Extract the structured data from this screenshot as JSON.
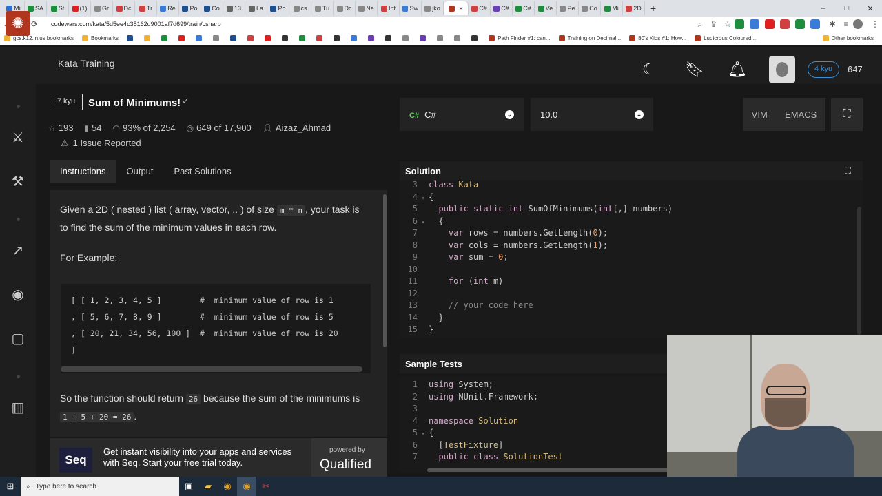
{
  "browser": {
    "tabs": [
      {
        "label": "Mi",
        "color": "#2a6fd6"
      },
      {
        "label": "SA",
        "color": "#1e8e3e"
      },
      {
        "label": "St",
        "color": "#1e8e3e"
      },
      {
        "label": "(1)",
        "color": "#e02020"
      },
      {
        "label": "Gr",
        "color": "#888888"
      },
      {
        "label": "Dc",
        "color": "#d04040"
      },
      {
        "label": "Tr",
        "color": "#d04040"
      },
      {
        "label": "Re",
        "color": "#3a7bd5"
      },
      {
        "label": "Po",
        "color": "#1f4f8f"
      },
      {
        "label": "Co",
        "color": "#1f4f8f"
      },
      {
        "label": "13",
        "color": "#666666"
      },
      {
        "label": "La",
        "color": "#666666"
      },
      {
        "label": "Po",
        "color": "#1f4f8f"
      },
      {
        "label": "cs",
        "color": "#888888"
      },
      {
        "label": "Tu",
        "color": "#888888"
      },
      {
        "label": "Dc",
        "color": "#888888"
      },
      {
        "label": "Ne",
        "color": "#888888"
      },
      {
        "label": "Int",
        "color": "#d04040"
      },
      {
        "label": "Sw",
        "color": "#3a7bd5"
      },
      {
        "label": "jko",
        "color": "#888888"
      },
      {
        "label": "",
        "color": "#b1361e",
        "active": true
      },
      {
        "label": "C#",
        "color": "#d04040"
      },
      {
        "label": "C#",
        "color": "#6a3fb5"
      },
      {
        "label": "C#",
        "color": "#1e8e3e"
      },
      {
        "label": "Ve",
        "color": "#1e8e3e"
      },
      {
        "label": "Pe",
        "color": "#888888"
      },
      {
        "label": "Co",
        "color": "#888888"
      },
      {
        "label": "Mi",
        "color": "#1e8e3e"
      },
      {
        "label": "2D",
        "color": "#d04040"
      }
    ],
    "new_tab_label": "+",
    "window_controls": [
      "–",
      "□",
      "✕"
    ],
    "url": "codewars.com/kata/5d5ee4c35162d9001af7d699/train/csharp",
    "bookmarks": [
      {
        "label": "gcs.k12.in.us bookmarks",
        "color": "#f2b233"
      },
      {
        "label": "Bookmarks",
        "color": "#f2b233"
      },
      {
        "label": "",
        "color": "#1f4f8f"
      },
      {
        "label": "",
        "color": "#f2b233"
      },
      {
        "label": "",
        "color": "#1e8e3e"
      },
      {
        "label": "",
        "color": "#e02020"
      },
      {
        "label": "",
        "color": "#3a7bd5"
      },
      {
        "label": "",
        "color": "#888888"
      },
      {
        "label": "",
        "color": "#1f4f8f"
      },
      {
        "label": "",
        "color": "#d04040"
      },
      {
        "label": "",
        "color": "#e02020"
      },
      {
        "label": "",
        "color": "#333333"
      },
      {
        "label": "",
        "color": "#1e8e3e"
      },
      {
        "label": "",
        "color": "#d04040"
      },
      {
        "label": "",
        "color": "#333333"
      },
      {
        "label": "",
        "color": "#3a7bd5"
      },
      {
        "label": "",
        "color": "#6a3fb5"
      },
      {
        "label": "",
        "color": "#333333"
      },
      {
        "label": "",
        "color": "#888888"
      },
      {
        "label": "",
        "color": "#6a3fb5"
      },
      {
        "label": "",
        "color": "#888888"
      },
      {
        "label": "",
        "color": "#888888"
      },
      {
        "label": "",
        "color": "#333333"
      },
      {
        "label": "Path Finder #1: can...",
        "color": "#b1361e"
      },
      {
        "label": "Training on Decimal...",
        "color": "#b1361e"
      },
      {
        "label": "80's Kids #1: How...",
        "color": "#b1361e"
      },
      {
        "label": "Ludicrous Coloured...",
        "color": "#b1361e"
      },
      {
        "label": "Other bookmarks",
        "color": "#f2b233"
      }
    ]
  },
  "topbar": {
    "section_title": "Kata Training",
    "rank": "4 kyu",
    "honor": "647"
  },
  "kata": {
    "kyu": "7 kyu",
    "title": "Sum of Minimums!",
    "check_icon": "✓",
    "stats": {
      "stars": "193",
      "bookmarks": "54",
      "satisfaction": "93% of 2,254",
      "completed": "649 of 17,900",
      "author": "Aizaz_Ahmad"
    },
    "issues": "1 Issue Reported"
  },
  "tabs": [
    "Instructions",
    "Output",
    "Past Solutions"
  ],
  "instructions": {
    "p1_a": "Given a 2D ( nested ) list ( array, vector, .. ) of size",
    "p1_code": "m * n",
    "p1_b": ", your task is to find the sum of the minimum values in each row.",
    "p2": "For Example:",
    "example_lines": [
      "[ [ 1, 2, 3, 4, 5 ]        #  minimum value of row is 1",
      ", [ 5, 6, 7, 8, 9 ]        #  minimum value of row is 5",
      ", [ 20, 21, 34, 56, 100 ]  #  minimum value of row is 20",
      "]"
    ],
    "p3_a": "So the function should return",
    "p3_code1": "26",
    "p3_b": "because the sum of the minimums is",
    "p3_code2": "1 + 5 + 20 = 26",
    "p3_c": "."
  },
  "ad": {
    "logo": "Seq",
    "text": "Get instant visibility into your apps and services with Seq. Start your free trial today.",
    "powered_by": "powered by",
    "brand": "Qualified"
  },
  "controls": {
    "language": "C#",
    "version": "10.0",
    "keymaps": [
      "VIM",
      "EMACS"
    ]
  },
  "solution": {
    "title": "Solution",
    "lines": [
      {
        "n": "3",
        "fold": "",
        "html": "<span class='kw'>class</span> <span class='ty'>Kata</span>"
      },
      {
        "n": "4",
        "fold": "▾",
        "html": "{"
      },
      {
        "n": "5",
        "fold": "",
        "html": "  <span class='kw'>public static int</span> SumOfMinimums(<span class='kw'>int</span>[,] numbers)"
      },
      {
        "n": "6",
        "fold": "▾",
        "html": "  {"
      },
      {
        "n": "7",
        "fold": "",
        "html": "    <span class='kw'>var</span> rows = numbers.GetLength(<span class='num'>0</span>);"
      },
      {
        "n": "8",
        "fold": "",
        "html": "    <span class='kw'>var</span> cols = numbers.GetLength(<span class='num'>1</span>);"
      },
      {
        "n": "9",
        "fold": "",
        "html": "    <span class='kw'>var</span> sum = <span class='num'>0</span>;"
      },
      {
        "n": "10",
        "fold": "",
        "html": ""
      },
      {
        "n": "11",
        "fold": "",
        "html": "    <span class='kw'>for</span> (<span class='kw'>int</span> m)"
      },
      {
        "n": "12",
        "fold": "",
        "html": ""
      },
      {
        "n": "13",
        "fold": "",
        "html": "    <span class='cm'>// your code here</span>"
      },
      {
        "n": "14",
        "fold": "",
        "html": "  }"
      },
      {
        "n": "15",
        "fold": "",
        "html": "}"
      }
    ]
  },
  "tests": {
    "title": "Sample Tests",
    "lines": [
      {
        "n": "1",
        "fold": "",
        "html": "<span class='kw'>using</span> System;"
      },
      {
        "n": "2",
        "fold": "",
        "html": "<span class='kw'>using</span> NUnit.Framework;"
      },
      {
        "n": "3",
        "fold": "",
        "html": ""
      },
      {
        "n": "4",
        "fold": "",
        "html": "<span class='kw'>namespace</span> <span class='ty'>Solution</span>"
      },
      {
        "n": "5",
        "fold": "▾",
        "html": "{"
      },
      {
        "n": "6",
        "fold": "",
        "html": "  [<span class='ty'>TestFixture</span>]"
      },
      {
        "n": "7",
        "fold": "",
        "html": "  <span class='kw'>public class</span> <span class='ty'>SolutionTest</span>"
      }
    ]
  },
  "taskbar": {
    "search_placeholder": "Type here to search"
  }
}
